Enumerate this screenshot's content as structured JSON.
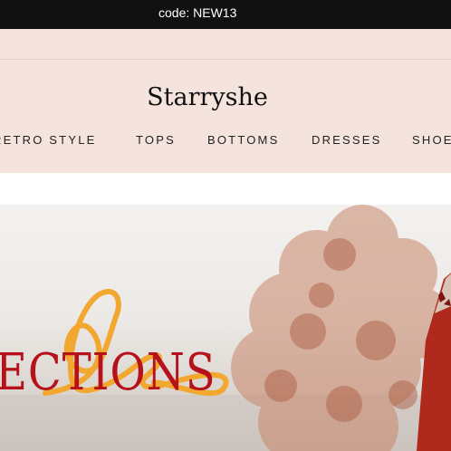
{
  "announcement": {
    "text": "code: NEW13"
  },
  "header": {
    "brand_name": "Starryshe",
    "nav_items": [
      "RETRO STYLE",
      "TOPS",
      "BOTTOMS",
      "DRESSES",
      "SHOES"
    ]
  },
  "hero": {
    "title_text": "LECTIONS",
    "script_text": "le"
  },
  "colors": {
    "announcement_bg": "#111111",
    "header_bg": "#f5e4dd",
    "hero_title": "#b5121b",
    "hero_script": "#f2a72f",
    "sweater": "#b0291d"
  },
  "icons": {
    "hero_image": "autumn-tree-sweater-photo"
  }
}
